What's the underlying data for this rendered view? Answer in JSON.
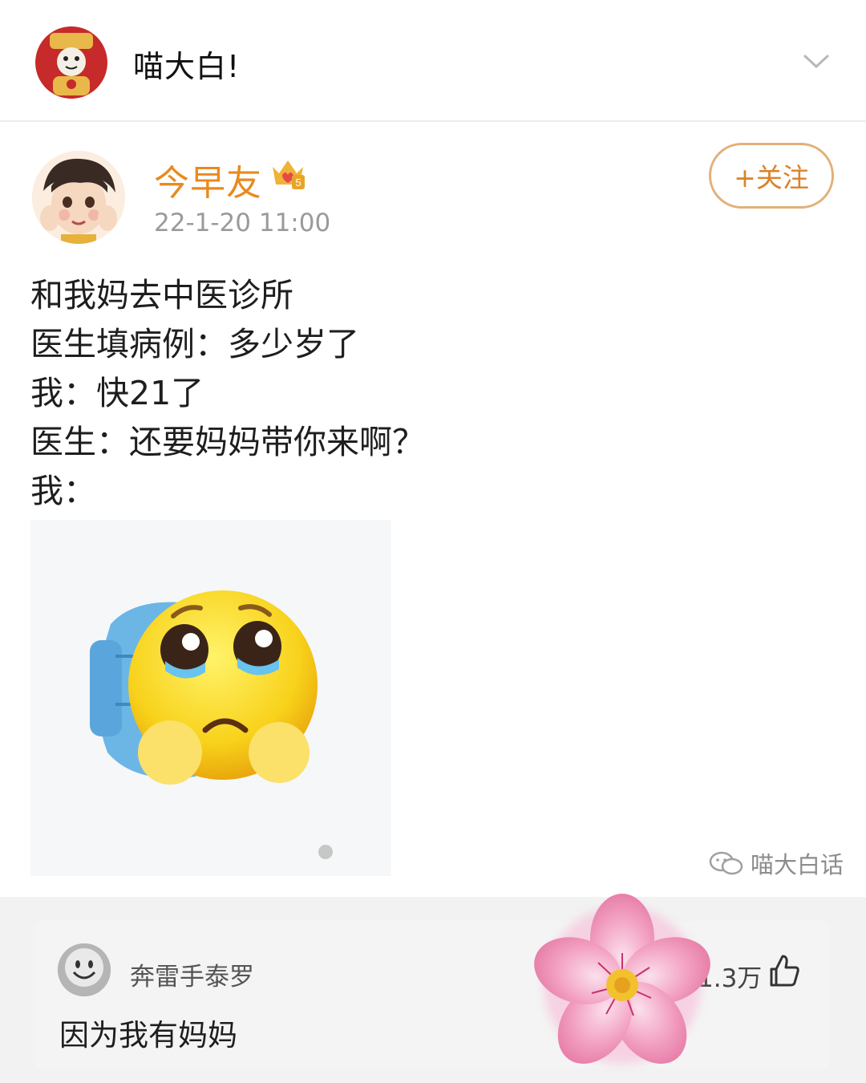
{
  "top_bar": {
    "account_name": "喵大白!",
    "avatar_icon": "avatar-icon",
    "expand_icon": "chevron-down-icon"
  },
  "post": {
    "author": "今早友",
    "vip_badge_icon": "vip-crown-badge-icon",
    "timestamp": "22-1-20 11:00",
    "follow_label": "+关注",
    "lines": [
      "和我妈去中医诊所",
      "医生填病例：多少岁了",
      "我：快21了",
      "医生：还要妈妈带你来啊？",
      "我："
    ],
    "image_icon": "crying-emoji-with-backpack-icon",
    "watermark": "喵大白话"
  },
  "comment": {
    "author": "奔雷手泰罗",
    "text": "因为我有妈妈",
    "likes": "1.3万",
    "like_icon": "thumbs-up-icon"
  },
  "decoration": {
    "flower_icon": "cherry-blossom-icon"
  },
  "colors": {
    "username": "#e98a1e",
    "follow_border": "#e3b07a",
    "timestamp": "#9a9a9a"
  }
}
